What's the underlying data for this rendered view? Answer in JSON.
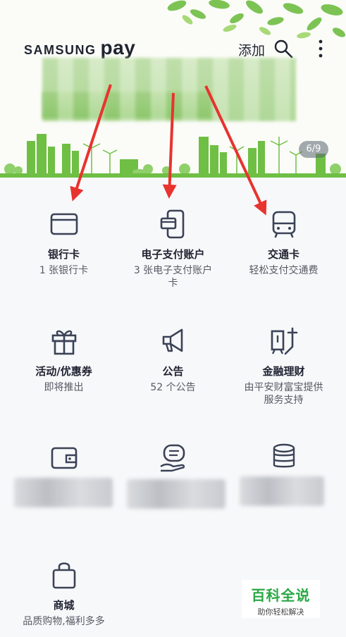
{
  "header": {
    "brand_samsung": "SAMSUNG",
    "brand_pay": "pay",
    "add_label": "添加",
    "page_indicator": "6/9"
  },
  "grid": {
    "bank_card": {
      "title": "银行卡",
      "subtitle": "1 张银行卡"
    },
    "e_payment": {
      "title": "电子支付账户",
      "subtitle": "3 张电子支付账户卡"
    },
    "transit": {
      "title": "交通卡",
      "subtitle": "轻松支付交通费"
    },
    "promo": {
      "title": "活动/优惠券",
      "subtitle": "即将推出"
    },
    "notice": {
      "title": "公告",
      "subtitle": "52 个公告"
    },
    "finance": {
      "title": "金融理财",
      "subtitle": "由平安财富宝提供服务支持"
    },
    "mall": {
      "title": "商城",
      "subtitle": "品质购物,福利多多"
    }
  },
  "watermark": {
    "title": "百科全说",
    "subtitle": "助你轻松解决"
  },
  "colors": {
    "accent_arrow": "#e8332f",
    "icon_stroke": "#3a4256",
    "banner_green": "#7cc354"
  }
}
